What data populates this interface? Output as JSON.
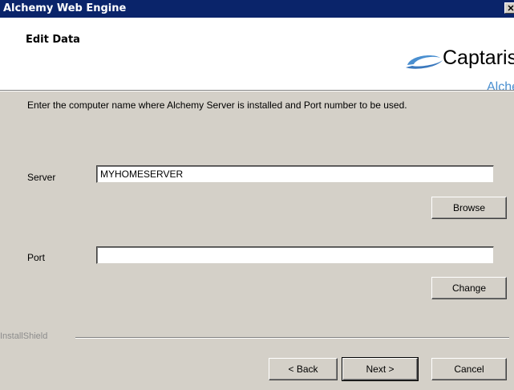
{
  "window": {
    "title": "Alchemy Web Engine",
    "close_glyph": "✕"
  },
  "header": {
    "title": "Edit Data",
    "logo_brand": "Captaris",
    "logo_product": "Alchemy"
  },
  "instructions": "Enter the computer name where Alchemy Server is installed and Port number to be used.",
  "server": {
    "label": "Server",
    "value": "MYHOMESERVER",
    "browse_label": "Browse"
  },
  "port": {
    "label": "Port",
    "value": "",
    "change_label": "Change"
  },
  "footer": {
    "installshield": "InstallShield",
    "back_label": "< Back",
    "next_label": "Next >",
    "cancel_label": "Cancel"
  },
  "colors": {
    "titlebar": "#0a246a",
    "dialog_bg": "#d4d0c8",
    "logo_blue": "#4a8fd0"
  }
}
